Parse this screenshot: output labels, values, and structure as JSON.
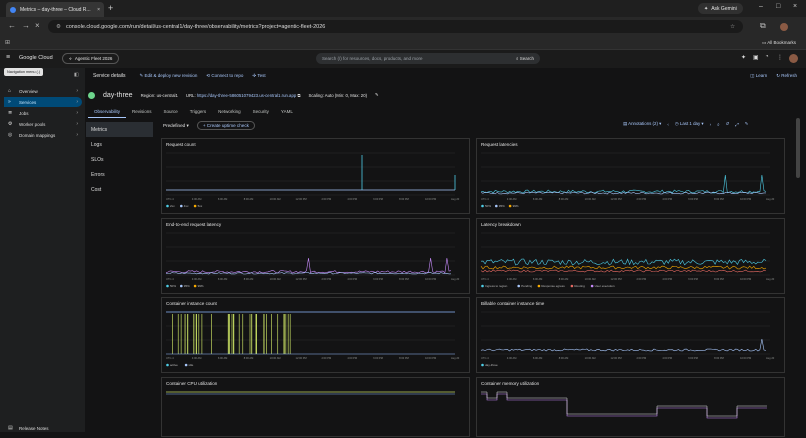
{
  "browser": {
    "tab_title": "Metrics – day-three – Cloud R...",
    "gemini": "Ask Gemini",
    "url": "console.cloud.google.com/run/detail/us-central1/day-three/observability/metrics?project=agentic-fleet-2026",
    "bookmarks": "All Bookmarks"
  },
  "gcp": {
    "logo": "Google Cloud",
    "project": "Agentic Fleet 2026",
    "search": "Search (/) for resources, docs, products, and more",
    "search_btn": "Search",
    "tooltip": "Navigation menu (.)"
  },
  "sidebar": {
    "items": [
      {
        "label": "Overview"
      },
      {
        "label": "Services"
      },
      {
        "label": "Jobs"
      },
      {
        "label": "Worker pools"
      },
      {
        "label": "Domain mappings"
      }
    ],
    "release_notes": "Release Notes"
  },
  "service": {
    "header": "Service details",
    "edit": "Edit & deploy new revision",
    "connect": "Connect to repo",
    "test": "Test",
    "learn": "Learn",
    "refresh": "Refresh",
    "name": "day-three",
    "region": "Region: us-central1",
    "url_label": "URL:",
    "url": "https://day-three-586051079423.us-central1.run.app",
    "scaling": "Scaling: Auto (Min: 0, Max: 20)"
  },
  "tabs": [
    "Observability",
    "Revisions",
    "Source",
    "Triggers",
    "Networking",
    "Security",
    "YAML"
  ],
  "subnav": [
    "Metrics",
    "Logs",
    "SLOs",
    "Errors",
    "Cost"
  ],
  "controls": {
    "predefined": "Predefined",
    "uptime": "Create uptime check",
    "annotations": "Annotations (2)",
    "range": "Last 1 day"
  },
  "cards": [
    {
      "title": "Request count",
      "legend": [
        "2xx",
        "4xx",
        "5xx"
      ]
    },
    {
      "title": "Request latencies",
      "legend": [
        "50%",
        "95%",
        "99%"
      ]
    },
    {
      "title": "End-to-end request latency",
      "legend": [
        "50%",
        "95%",
        "99%"
      ]
    },
    {
      "title": "Latency breakdown",
      "legend": [
        "Ingress to region",
        "Pending",
        "Response egress",
        "Routing",
        "User execution"
      ]
    },
    {
      "title": "Container instance count",
      "legend": [
        "active",
        "idle"
      ]
    },
    {
      "title": "Billable container instance time",
      "legend": [
        "day-three"
      ]
    },
    {
      "title": "Container CPU utilization",
      "legend": []
    },
    {
      "title": "Container memory utilization",
      "legend": []
    }
  ],
  "xticks": [
    "UTC-4",
    "4:00 AM",
    "6:00 AM",
    "8:00 AM",
    "10:00 AM",
    "12:00 PM",
    "2:00 PM",
    "4:00 PM",
    "6:00 PM",
    "8:00 PM",
    "10:00 PM",
    "Aug 20"
  ]
}
